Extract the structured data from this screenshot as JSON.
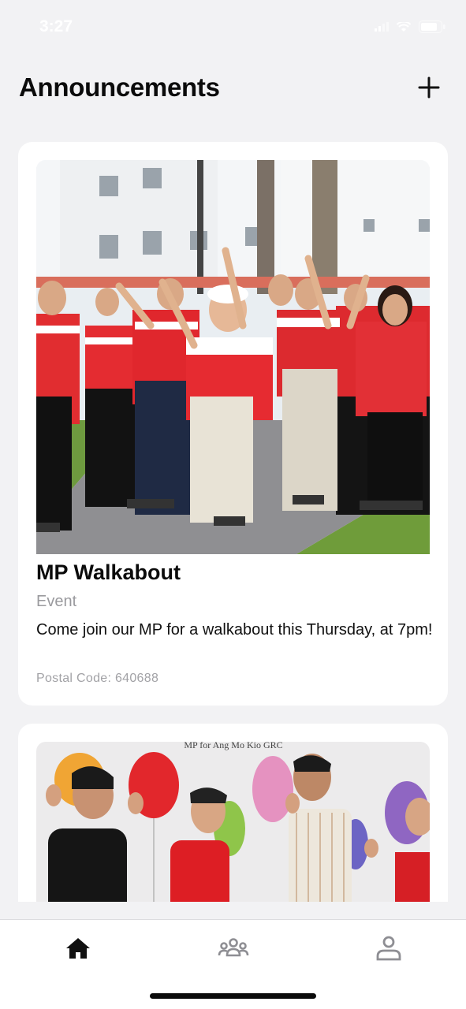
{
  "status_bar": {
    "time": "3:27",
    "icons": [
      "cellular-signal-icon",
      "wifi-icon",
      "battery-icon"
    ]
  },
  "header": {
    "title": "Announcements",
    "add_icon": "plus-icon"
  },
  "announcements": [
    {
      "title": "MP Walkabout",
      "category": "Event",
      "description": "Come join our MP for a walkabout this Thursday, at 7pm!",
      "postal_code": "Postal Code: 640688",
      "image": "photo of MP walkabout group in red shirts"
    },
    {
      "image": "photo of MP with balloons",
      "image_caption": "MP for Ang Mo Kio GRC"
    }
  ],
  "tab_bar": {
    "tabs": [
      {
        "icon": "home-icon",
        "active": true
      },
      {
        "icon": "community-icon",
        "active": false
      },
      {
        "icon": "profile-icon",
        "active": false
      }
    ],
    "active_color": "#111111",
    "inactive_color": "#8e8e93"
  }
}
